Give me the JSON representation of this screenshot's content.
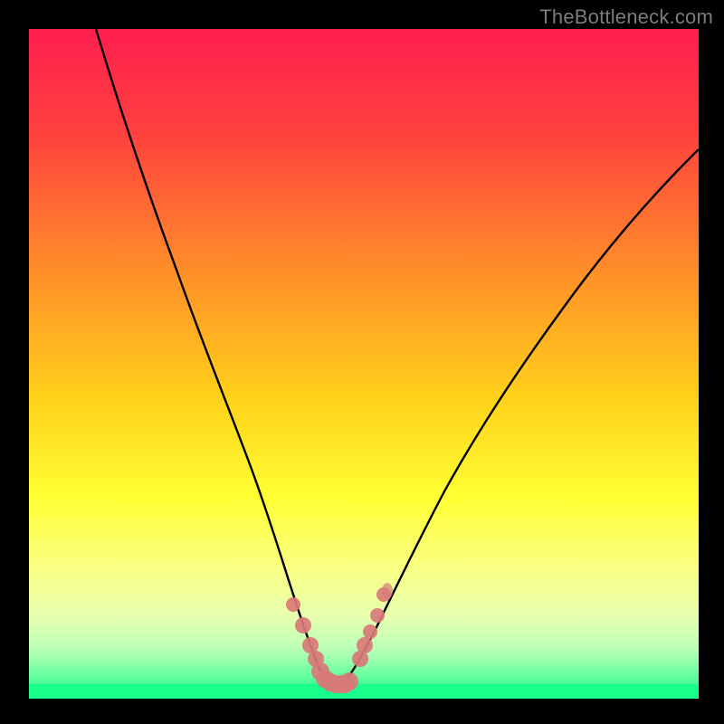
{
  "watermark": "TheBottleneck.com",
  "chart_data": {
    "type": "line",
    "title": "",
    "xlabel": "",
    "ylabel": "",
    "xlim": [
      0,
      100
    ],
    "ylim": [
      0,
      100
    ],
    "grid": false,
    "legend": false,
    "background_gradient": {
      "direction": "vertical",
      "stops": [
        {
          "pos": 0.0,
          "color": "#ff1f4f"
        },
        {
          "pos": 0.15,
          "color": "#ff3f3f"
        },
        {
          "pos": 0.35,
          "color": "#ff8a2a"
        },
        {
          "pos": 0.55,
          "color": "#ffd11a"
        },
        {
          "pos": 0.7,
          "color": "#ffff33"
        },
        {
          "pos": 0.8,
          "color": "#faff80"
        },
        {
          "pos": 0.88,
          "color": "#e6ffb0"
        },
        {
          "pos": 0.93,
          "color": "#b4ffb4"
        },
        {
          "pos": 0.97,
          "color": "#5cff9c"
        },
        {
          "pos": 1.0,
          "color": "#00e58a"
        }
      ]
    },
    "series": [
      {
        "name": "bottleneck-curve",
        "type": "line",
        "x": [
          10,
          14,
          18,
          22,
          26,
          30,
          33,
          36,
          38.5,
          40.5,
          42,
          43,
          44,
          45,
          46,
          47,
          48.5,
          50,
          52,
          55,
          58,
          62,
          66,
          70,
          75,
          80,
          86,
          92,
          98
        ],
        "y": [
          100,
          87,
          75,
          64,
          53,
          43,
          35,
          28,
          22,
          17,
          12,
          8,
          5,
          3,
          2.2,
          2.5,
          4,
          7,
          12,
          19,
          26,
          34,
          41,
          48,
          55,
          61,
          67,
          72,
          76
        ]
      },
      {
        "name": "bottom-cluster",
        "type": "scatter",
        "marker": "circle",
        "color": "#d87a78",
        "x": [
          39.5,
          41.0,
          42.0,
          42.8,
          43.5,
          44.2,
          45.0,
          45.8,
          46.6,
          47.2,
          47.8,
          49.5,
          50.2,
          51.0,
          52.0,
          53.0
        ],
        "y": [
          14.0,
          11.0,
          8.0,
          6.0,
          4.0,
          3.0,
          2.5,
          2.2,
          2.2,
          2.2,
          2.5,
          6.0,
          8.0,
          10.0,
          12.5,
          15.5
        ]
      },
      {
        "name": "green-band",
        "type": "area",
        "color": "#19ff8c",
        "x": [
          0,
          100
        ],
        "y_top": [
          2,
          2
        ],
        "y_bottom": [
          0,
          0
        ]
      }
    ]
  }
}
